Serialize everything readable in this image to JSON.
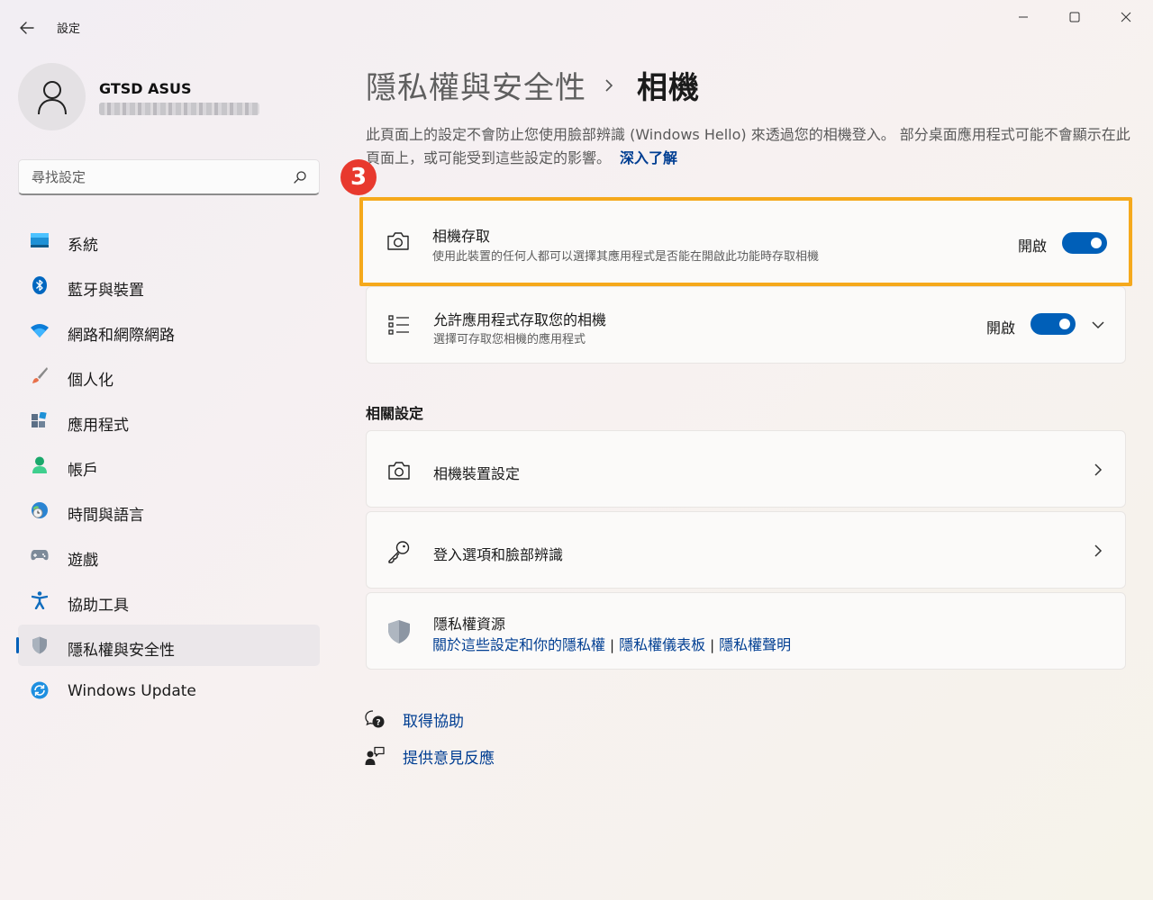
{
  "window": {
    "app_title": "設定",
    "colors": {
      "accent": "#005fb8",
      "highlight": "#f5a91c",
      "badge": "#e8392e",
      "link": "#003e92"
    }
  },
  "profile": {
    "name": "GTSD ASUS",
    "avatar_icon": "person-icon"
  },
  "search": {
    "placeholder": "尋找設定",
    "value": ""
  },
  "sidebar": {
    "items": [
      {
        "label": "系統",
        "icon": "system-icon"
      },
      {
        "label": "藍牙與裝置",
        "icon": "bluetooth-icon"
      },
      {
        "label": "網路和網際網路",
        "icon": "wifi-icon"
      },
      {
        "label": "個人化",
        "icon": "brush-icon"
      },
      {
        "label": "應用程式",
        "icon": "apps-icon"
      },
      {
        "label": "帳戶",
        "icon": "account-icon"
      },
      {
        "label": "時間與語言",
        "icon": "time-language-icon"
      },
      {
        "label": "遊戲",
        "icon": "gamepad-icon"
      },
      {
        "label": "協助工具",
        "icon": "accessibility-icon"
      },
      {
        "label": "隱私權與安全性",
        "icon": "shield-icon",
        "active": true
      },
      {
        "label": "Windows Update",
        "icon": "update-icon"
      }
    ]
  },
  "main": {
    "breadcrumb": {
      "parent": "隱私權與安全性",
      "current": "相機"
    },
    "description": "此頁面上的設定不會防止您使用臉部辨識 (Windows Hello) 來透過您的相機登入。 部分桌面應用程式可能不會顯示在此頁面上，或可能受到這些設定的影響。",
    "learn_more": "深入了解",
    "step_badge": "3",
    "camera_access": {
      "title": "相機存取",
      "subtitle": "使用此裝置的任何人都可以選擇其應用程式是否能在開啟此功能時存取相機",
      "state": "開啟"
    },
    "app_access": {
      "title": "允許應用程式存取您的相機",
      "subtitle": "選擇可存取您相機的應用程式",
      "state": "開啟"
    },
    "related_title": "相關設定",
    "related": {
      "camera_settings": "相機裝置設定",
      "signin_options": "登入選項和臉部辨識",
      "privacy_resources": {
        "title": "隱私權資源",
        "links": [
          "關於這些設定和你的隱私權",
          "隱私權儀表板",
          "隱私權聲明"
        ]
      }
    },
    "help": {
      "get_help": "取得協助",
      "feedback": "提供意見反應"
    }
  }
}
